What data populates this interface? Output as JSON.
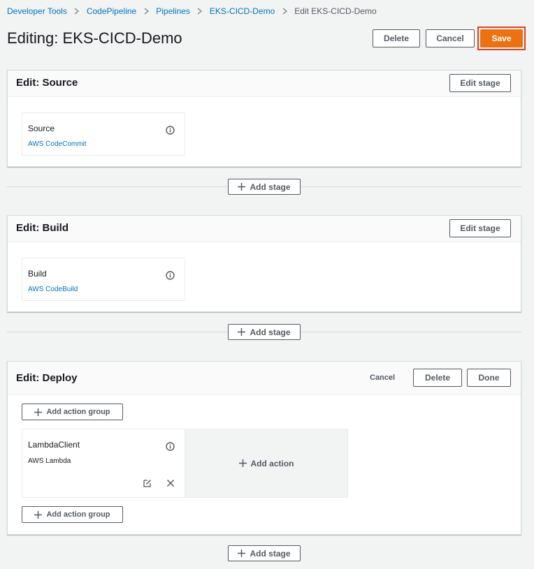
{
  "breadcrumb": {
    "items": [
      "Developer Tools",
      "CodePipeline",
      "Pipelines",
      "EKS-CICD-Demo"
    ],
    "current": "Edit EKS-CICD-Demo"
  },
  "page": {
    "title": "Editing: EKS-CICD-Demo"
  },
  "header_actions": {
    "delete": "Delete",
    "cancel": "Cancel",
    "save": "Save"
  },
  "stages": [
    {
      "title": "Edit: Source",
      "edit_label": "Edit stage",
      "action": {
        "name": "Source",
        "provider": "AWS CodeCommit"
      }
    },
    {
      "title": "Edit: Build",
      "edit_label": "Edit stage",
      "action": {
        "name": "Build",
        "provider": "AWS CodeBuild"
      }
    },
    {
      "title": "Edit: Deploy",
      "cancel_label": "Cancel",
      "delete_label": "Delete",
      "done_label": "Done",
      "add_action_group_label": "Add action group",
      "add_action_label": "Add action",
      "action": {
        "name": "LambdaClient",
        "provider": "AWS Lambda"
      }
    }
  ],
  "add_stage_label": "Add stage",
  "colors": {
    "accent": "#ec7211",
    "link": "#0073bb",
    "highlight": "#e0401f"
  }
}
